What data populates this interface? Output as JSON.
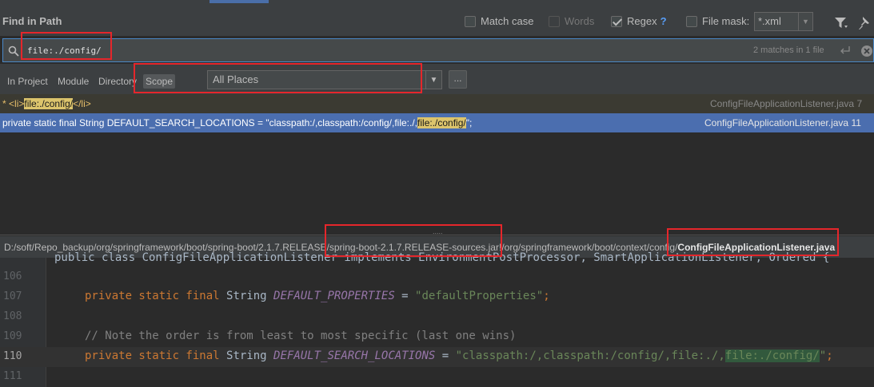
{
  "dialog": {
    "title": "Find in Path"
  },
  "options": {
    "match_case": {
      "label": "Match case",
      "checked": false
    },
    "words": {
      "label": "Words",
      "checked": false,
      "disabled": true
    },
    "regex": {
      "label": "Regex",
      "checked": true,
      "help": "?"
    },
    "file_mask": {
      "label": "File mask:",
      "checked": false,
      "value": "*.xml"
    }
  },
  "search": {
    "query": "file:./config/",
    "match_count": "2 matches in 1 file"
  },
  "scope_tabs": [
    "In Project",
    "Module",
    "Directory",
    "Scope"
  ],
  "scope": {
    "selected_tab": "Scope",
    "value": "All Places",
    "more_button": "..."
  },
  "results": [
    {
      "prefix": "* ",
      "tag_open": "<li>",
      "match": "file:./config/",
      "tag_close": "</li>",
      "file": "ConfigFileApplicationListener.java 7"
    },
    {
      "prefix": "private static final String DEFAULT_SEARCH_LOCATIONS = \"classpath:/,classpath:/config/,file:./,",
      "match": "file:./config/",
      "suffix": "\";",
      "file": "ConfigFileApplicationListener.java 11"
    }
  ],
  "splitter_grip": ".....",
  "path": {
    "prefix": "D:/soft/Repo_backup/org/springframework/boot/spring-boot/2.1.7.RELEASE/spring-boot-2.1.7.RELEASE-sources.jar!/org/springframework/boot/context/config/",
    "filename": "ConfigFileApplicationListener.java"
  },
  "editor": {
    "partial_line": "public class ConfigFileApplicationListener implements EnvironmentPostProcessor, SmartApplicationListener, Ordered {",
    "lines": [
      {
        "num": "106"
      },
      {
        "num": "107",
        "kw": "private static final ",
        "type": "String ",
        "name": "DEFAULT_PROPERTIES",
        "eq": " = ",
        "str": "\"defaultProperties\"",
        "end": ";"
      },
      {
        "num": "108"
      },
      {
        "num": "109",
        "comment": "// Note the order is from least to most specific (last one wins)"
      },
      {
        "num": "110",
        "kw": "private static final ",
        "type": "String ",
        "name": "DEFAULT_SEARCH_LOCATIONS",
        "eq": " = ",
        "str_a": "\"classpath:/,classpath:/config/,file:./,",
        "str_hl": "file:./config/",
        "str_b": "\"",
        "end": ";"
      },
      {
        "num": "111"
      }
    ]
  }
}
